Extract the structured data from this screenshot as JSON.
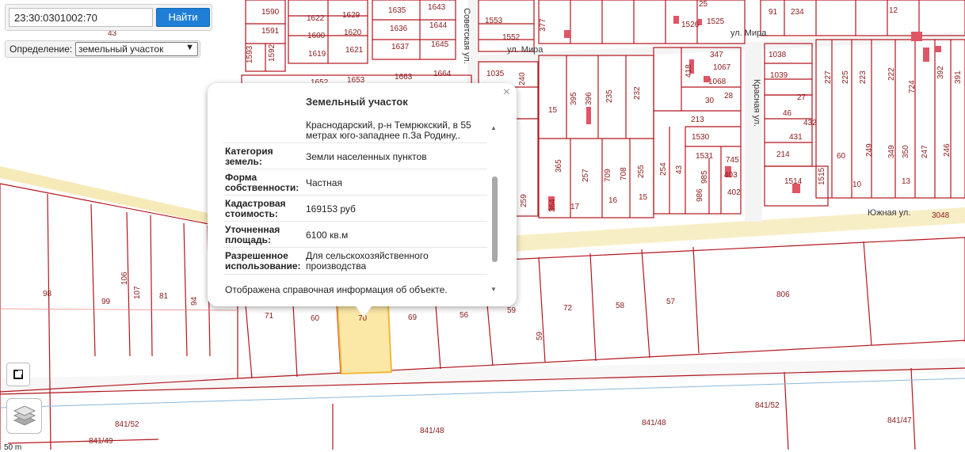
{
  "search": {
    "value": "23:30:0301002:70",
    "button_label": "Найти"
  },
  "definition": {
    "label": "Определение:",
    "selected": "земельный участок"
  },
  "scale_label": "50 m",
  "popup": {
    "title": "Земельный участок",
    "address": "Краснодарский, р-н Темрюкский, в 55 метрах юго-западнее п.За Родину,.",
    "rows": [
      {
        "key": "Категория земель:",
        "value": "Земли населенных пунктов"
      },
      {
        "key": "Форма собственности:",
        "value": "Частная"
      },
      {
        "key": "Кадастровая стоимость:",
        "value": "169153 руб"
      },
      {
        "key": "Уточненная площадь:",
        "value": "6100 кв.м"
      },
      {
        "key": "Разрешенное использование:",
        "value": "Для сельскохозяйственного производства"
      }
    ],
    "footer": "Отображена справочная информация об объекте.",
    "close_symbol": "×"
  },
  "map": {
    "streets": [
      "Советская ул.",
      "ул. Мира",
      "ул. Мира",
      "Красная ул.",
      "Южная ул."
    ],
    "parcel_labels": [
      "1590",
      "1591",
      "1593",
      "1592",
      "43",
      "1622",
      "1600",
      "1619",
      "1629",
      "1620",
      "1621",
      "1635",
      "1636",
      "1637",
      "1643",
      "1644",
      "1645",
      "1553",
      "1552",
      "377",
      "1652",
      "1653",
      "1663",
      "1664",
      "1035",
      "240",
      "395",
      "396",
      "235",
      "232",
      "15",
      "213",
      "1530",
      "1531",
      "745",
      "403",
      "402",
      "985",
      "986",
      "1067",
      "1068",
      "418",
      "347",
      "30",
      "28",
      "365",
      "257",
      "709",
      "708",
      "255",
      "254",
      "43",
      "259",
      "364",
      "17",
      "16",
      "15",
      "1038",
      "1039",
      "27",
      "46",
      "432",
      "431",
      "214",
      "1514",
      "1515",
      "60",
      "249",
      "349",
      "350",
      "247",
      "246",
      "227",
      "225",
      "223",
      "222",
      "724",
      "392",
      "391",
      "10",
      "13",
      "234",
      "1526",
      "1525",
      "25",
      "91",
      "12",
      "3048",
      "98",
      "99",
      "106",
      "107",
      "81",
      "94",
      "71",
      "60",
      "70",
      "69",
      "56",
      "59",
      "72",
      "58",
      "57",
      "806",
      "59",
      "841/52",
      "841/52",
      "841/48",
      "841/48",
      "841/47",
      "841/49"
    ]
  }
}
